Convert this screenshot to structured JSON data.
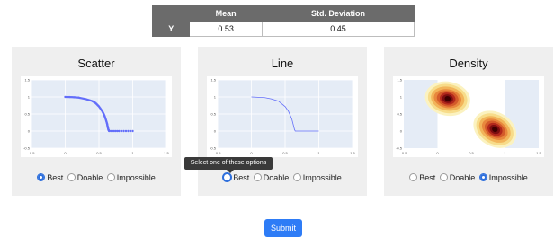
{
  "stats_table": {
    "headers": [
      "",
      "Mean",
      "Std. Deviation"
    ],
    "rows": [
      {
        "label": "Y",
        "mean": "0.53",
        "std": "0.45"
      }
    ]
  },
  "panels": [
    {
      "title": "Scatter",
      "options": [
        {
          "label": "Best",
          "selected": true
        },
        {
          "label": "Doable",
          "selected": false
        },
        {
          "label": "Impossible",
          "selected": false
        }
      ]
    },
    {
      "title": "Line",
      "options": [
        {
          "label": "Best",
          "selected": false
        },
        {
          "label": "Doable",
          "selected": false
        },
        {
          "label": "Impossible",
          "selected": false
        }
      ]
    },
    {
      "title": "Density",
      "options": [
        {
          "label": "Best",
          "selected": false
        },
        {
          "label": "Doable",
          "selected": false
        },
        {
          "label": "Impossible",
          "selected": true
        }
      ]
    }
  ],
  "tooltip": "Select one of these options",
  "submit_label": "Submit",
  "colors": {
    "accent": "#2e7cf6",
    "plot_bg": "#e5ecf6",
    "marker": "#636efa"
  },
  "chart_data": [
    {
      "type": "scatter",
      "x_ticks": [
        "-0.5",
        "0",
        "0.5",
        "1",
        "1.5"
      ],
      "y_ticks": [
        "-0.5",
        "0",
        "0.5",
        "1",
        "1.5"
      ],
      "xlim": [
        -0.5,
        1.5
      ],
      "ylim": [
        -0.5,
        1.5
      ],
      "series": [
        {
          "points": [
            [
              0,
              1
            ],
            [
              0.1,
              0.995
            ],
            [
              0.2,
              0.98
            ],
            [
              0.3,
              0.94
            ],
            [
              0.4,
              0.88
            ],
            [
              0.45,
              0.82
            ],
            [
              0.5,
              0.72
            ],
            [
              0.55,
              0.58
            ],
            [
              0.58,
              0.46
            ],
            [
              0.6,
              0.35
            ],
            [
              0.62,
              0.22
            ],
            [
              0.63,
              0.12
            ],
            [
              0.64,
              0.04
            ],
            [
              0.65,
              0
            ],
            [
              0.8,
              0
            ],
            [
              1,
              0
            ]
          ]
        }
      ]
    },
    {
      "type": "line",
      "x_ticks": [
        "-0.5",
        "0",
        "0.5",
        "1",
        "1.5"
      ],
      "y_ticks": [
        "-0.5",
        "0",
        "0.5",
        "1",
        "1.5"
      ],
      "xlim": [
        -0.5,
        1.5
      ],
      "ylim": [
        -0.5,
        1.5
      ],
      "series": [
        {
          "points": [
            [
              0,
              1
            ],
            [
              0.2,
              0.98
            ],
            [
              0.3,
              0.94
            ],
            [
              0.4,
              0.88
            ],
            [
              0.5,
              0.72
            ],
            [
              0.55,
              0.58
            ],
            [
              0.6,
              0.35
            ],
            [
              0.64,
              0.04
            ],
            [
              0.65,
              0
            ],
            [
              1,
              0
            ]
          ]
        }
      ]
    },
    {
      "type": "heatmap",
      "x_ticks": [
        "-0.5",
        "0",
        "0.5",
        "1",
        "1.5"
      ],
      "y_ticks": [
        "-0.5",
        "0",
        "0.5",
        "1",
        "1.5"
      ],
      "xlim": [
        -0.5,
        1.5
      ],
      "ylim": [
        -0.5,
        1.5
      ],
      "peaks": [
        {
          "x": 0.15,
          "y": 0.95
        },
        {
          "x": 0.85,
          "y": 0.05
        }
      ]
    }
  ]
}
